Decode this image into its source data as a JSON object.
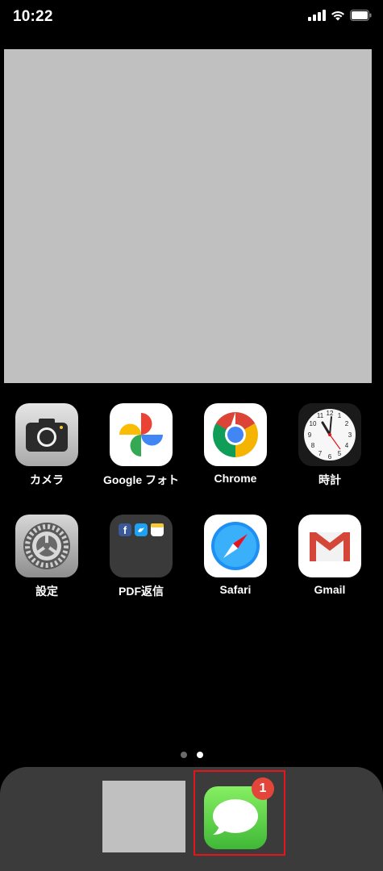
{
  "status_bar": {
    "time": "10:22",
    "icons": [
      "signal-bars-icon",
      "wifi-icon",
      "battery-icon"
    ]
  },
  "home": {
    "apps": [
      {
        "label": "カメラ",
        "icon": "camera-icon"
      },
      {
        "label": "Google フォト",
        "icon": "google-photos-icon"
      },
      {
        "label": "Chrome",
        "icon": "chrome-icon"
      },
      {
        "label": "時計",
        "icon": "clock-icon"
      },
      {
        "label": "設定",
        "icon": "settings-gear-icon"
      },
      {
        "label": "PDF返信",
        "icon": "folder-icon"
      },
      {
        "label": "Safari",
        "icon": "safari-compass-icon"
      },
      {
        "label": "Gmail",
        "icon": "gmail-icon"
      }
    ],
    "page_count": 2,
    "current_page": 2
  },
  "dock": {
    "messages_badge": "1",
    "messages_icon": "messages-icon"
  },
  "colors": {
    "background": "#000000",
    "placeholder": "#c0c0c0",
    "dock": "#3b3b3b",
    "badge": "#e2463a",
    "highlight": "#e8141b",
    "messages_green": "#4cd964"
  }
}
